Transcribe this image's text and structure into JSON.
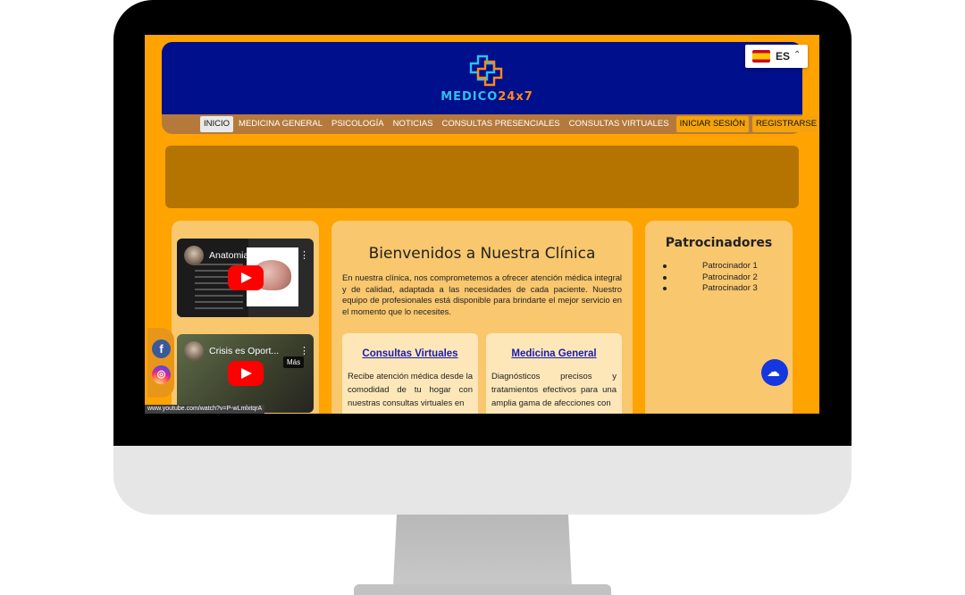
{
  "header": {
    "logo_text_a": "MEDICO",
    "logo_text_b": "24x7",
    "logo_icon": "medical-cross-icon"
  },
  "language": {
    "code": "ES",
    "caret": "⌃",
    "flag_icon": "spain-flag-icon"
  },
  "nav": {
    "items": [
      {
        "label": "INICIO"
      },
      {
        "label": "MEDICINA GENERAL"
      },
      {
        "label": "PSICOLOGÍA"
      },
      {
        "label": "NOTICIAS"
      },
      {
        "label": "CONSULTAS PRESENCIALES"
      },
      {
        "label": "CONSULTAS VIRTUALES"
      },
      {
        "label": "INICIAR SESIÓN"
      },
      {
        "label": "REGISTRARSE"
      }
    ]
  },
  "videos": [
    {
      "title": "Anatomia del C...",
      "menu": "⋮"
    },
    {
      "title": "Crisis es Oport...",
      "menu": "⋮",
      "more": "Más"
    }
  ],
  "status_url": "www.youtube.com/watch?v=P-wLmlxtqrA",
  "social": {
    "facebook": "f",
    "instagram": "◎"
  },
  "welcome": {
    "title": "Bienvenidos a Nuestra Clínica",
    "text": "En nuestra clínica, nos comprometemos a ofrecer atención médica integral y de calidad, adaptada a las necesidades de cada paciente. Nuestro equipo de profesionales está disponible para brindarte el mejor servicio en el momento que lo necesites."
  },
  "cards": [
    {
      "title": "Consultas Virtuales",
      "text": "Recibe atención médica desde la comodidad de tu hogar con nuestras consultas virtuales en"
    },
    {
      "title": "Medicina General",
      "text": "Diagnósticos precisos y tratamientos efectivos para una amplia gama de afecciones con"
    }
  ],
  "sponsors": {
    "title": "Patrocinadores",
    "items": [
      "Patrocinador 1",
      "Patrocinador 2",
      "Patrocinador 3"
    ]
  },
  "cloud_button": {
    "icon": "soundcloud-icon",
    "glyph": "☁"
  },
  "colors": {
    "page_bg": "#ffa300",
    "header_bg": "#000f8c",
    "nav_bg": "#b57a3b",
    "banner_bg": "#b57300",
    "panel_bg": "#f8c76e",
    "card_bg": "#fde7b9",
    "link": "#1a1ab0"
  }
}
